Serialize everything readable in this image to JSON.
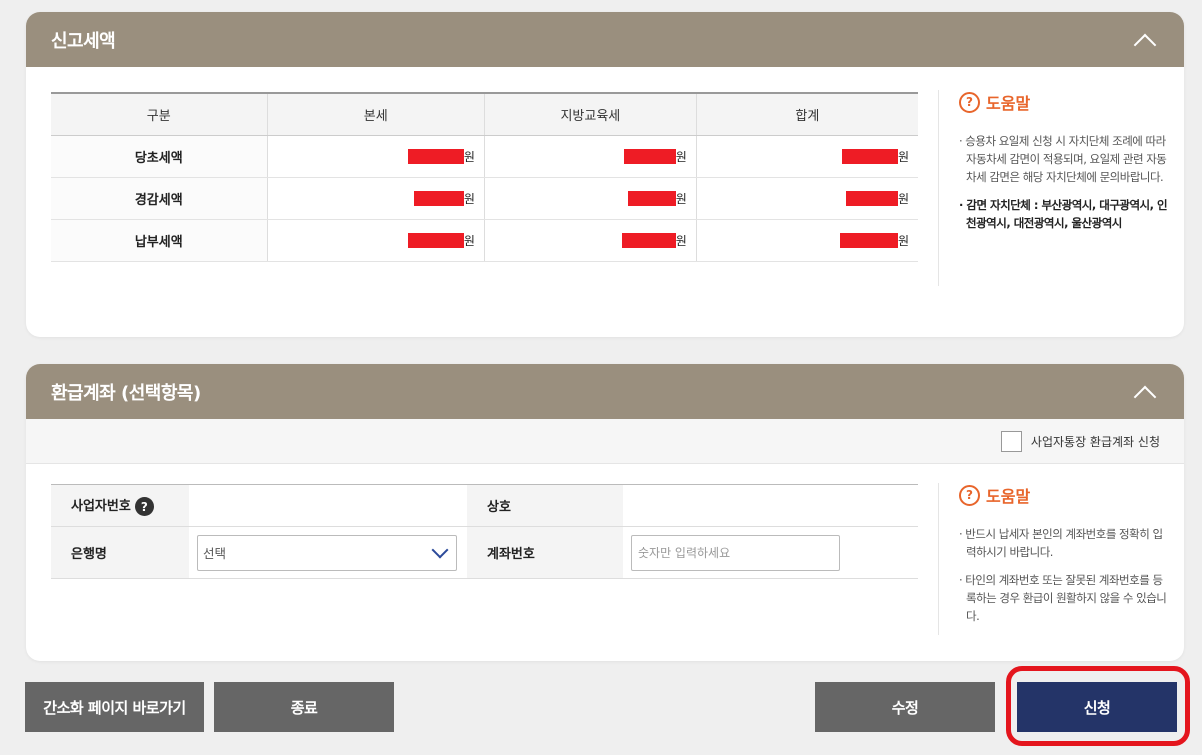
{
  "tax_panel": {
    "title": "신고세액",
    "columns": [
      "구분",
      "본세",
      "지방교육세",
      "합계"
    ],
    "rows": [
      {
        "label": "당초세액",
        "unit": "원"
      },
      {
        "label": "경감세액",
        "unit": "원"
      },
      {
        "label": "납부세액",
        "unit": "원"
      }
    ],
    "help": {
      "title": "도움말",
      "items": [
        "· 승용차 요일제 신청 시 자치단체 조례에 따라 자동차세 감면이 적용되며, 요일제 관련 자동차세 감면은 해당 자치단체에 문의바랍니다.",
        "· 감면 자치단체 : 부산광역시, 대구광역시, 인천광역시, 대전광역시, 울산광역시"
      ]
    }
  },
  "refund_panel": {
    "title": "환급계좌 (선택항목)",
    "business_account_label": "사업자통장 환급계좌 신청",
    "fields": {
      "business_number_label": "사업자번호",
      "company_label": "상호",
      "bank_label": "은행명",
      "bank_selected": "선택",
      "account_label": "계좌번호",
      "account_placeholder": "숫자만 입력하세요"
    },
    "help": {
      "title": "도움말",
      "items": [
        "· 반드시 납세자 본인의 계좌번호를 정확히 입력하시기 바랍니다.",
        "· 타인의 계좌번호 또는 잘못된 계좌번호를 등록하는 경우 환급이 원활하지 않을 수 있습니다."
      ]
    }
  },
  "buttons": {
    "simple": "간소화 페이지 바로가기",
    "exit": "종료",
    "edit": "수정",
    "submit": "신청"
  },
  "colors": {
    "header": "#9a8f7e",
    "submit": "#243468",
    "button": "#666666",
    "highlight": "#e4151d",
    "redaction": "#ee1c25",
    "help": "#e8652b"
  }
}
